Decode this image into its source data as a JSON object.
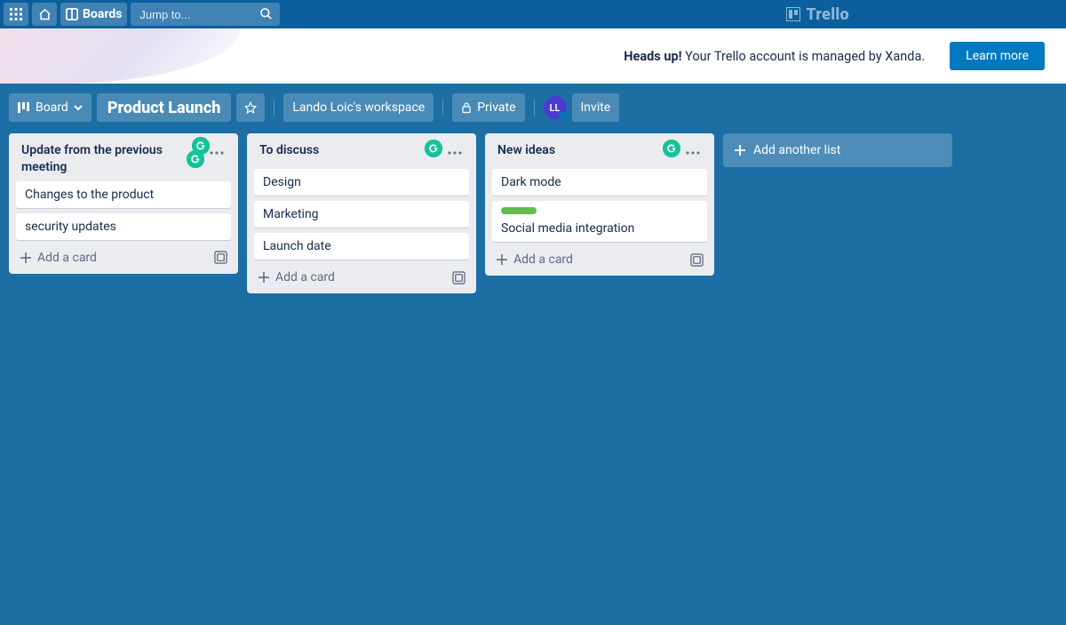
{
  "topbar": {
    "boards_label": "Boards",
    "search_placeholder": "Jump to...",
    "logo_text": "Trello"
  },
  "banner": {
    "headline": "Heads up!",
    "body": " Your Trello account is managed by Xanda.",
    "cta": "Learn more"
  },
  "board_header": {
    "view_label": "Board",
    "title": "Product Launch",
    "workspace": "Lando Loic's workspace",
    "visibility": "Private",
    "invite_label": "Invite",
    "avatar_initials": "LL"
  },
  "lists": [
    {
      "title": "Update from the previous meeting",
      "cards": [
        {
          "text": "Changes to the product"
        },
        {
          "text": "security updates"
        }
      ]
    },
    {
      "title": "To discuss",
      "cards": [
        {
          "text": "Design"
        },
        {
          "text": "Marketing"
        },
        {
          "text": "Launch date"
        }
      ]
    },
    {
      "title": "New ideas",
      "cards": [
        {
          "text": "Dark mode"
        },
        {
          "text": "Social media integration",
          "has_green_label": true
        }
      ]
    }
  ],
  "add_card_label": "Add a card",
  "add_list_label": "Add another list"
}
